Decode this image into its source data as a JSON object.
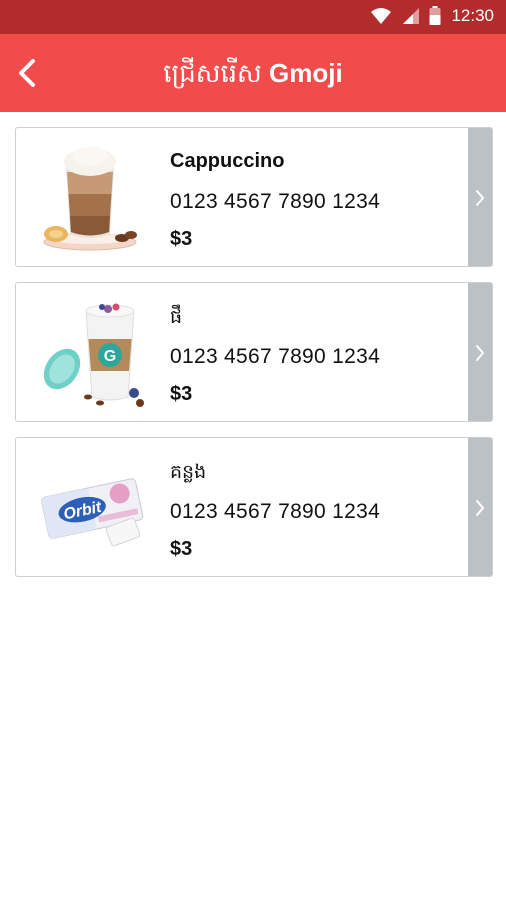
{
  "status_bar": {
    "time": "12:30",
    "icons": [
      "wifi-icon",
      "cell-signal-icon",
      "battery-icon"
    ]
  },
  "app_bar": {
    "title_khmer": "ជ្រើសរើស",
    "title_brand": "Gmoji",
    "back_icon": "chevron-left-icon"
  },
  "colors": {
    "status_bar": "#b32c2c",
    "app_bar": "#f24b4b",
    "arrow_panel": "#bcc1c6"
  },
  "items": [
    {
      "name": "Cappuccino",
      "number": "0123 4567 7890 1234",
      "price": "$3",
      "image": "cappuccino-image"
    },
    {
      "name": "ផឹ",
      "number": "0123 4567 7890 1234",
      "price": "$3",
      "image": "coffee-cup-image"
    },
    {
      "name": "គន្លង",
      "number": "0123 4567 7890 1234",
      "price": "$3",
      "image": "orbit-gum-image"
    }
  ]
}
